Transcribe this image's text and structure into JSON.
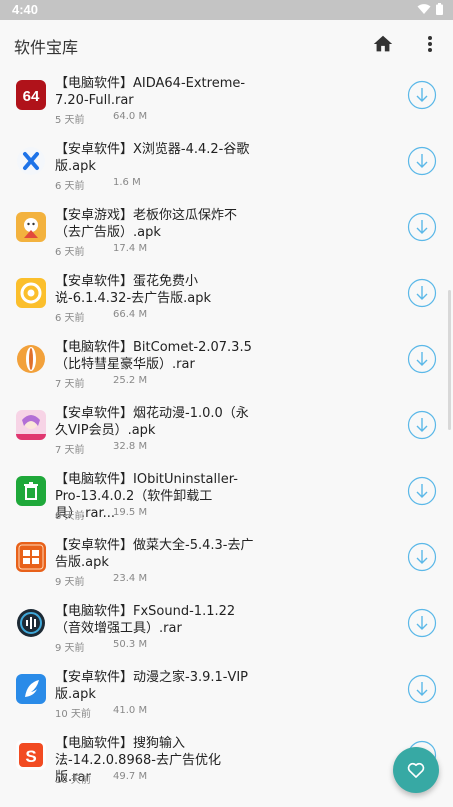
{
  "status_bar": {
    "time": "4:40"
  },
  "app_bar": {
    "title": "软件宝库",
    "home_icon": "home-icon",
    "more_icon": "more-vert-icon"
  },
  "items": [
    {
      "name": "【电脑软件】AIDA64-Extreme-7.20-Full.rar",
      "date": "5 天前",
      "size": "64.0 M",
      "icon": "aida64-icon"
    },
    {
      "name": "【安卓软件】X浏览器-4.4.2-谷歌版.apk",
      "date": "6 天前",
      "size": "1.6 M",
      "icon": "x-browser-icon"
    },
    {
      "name": "【安卓游戏】老板你这瓜保炸不（去广告版）.apk",
      "date": "6 天前",
      "size": "17.4 M",
      "icon": "melon-game-icon"
    },
    {
      "name": "【安卓软件】蛋花免费小说-6.1.4.32-去广告版.apk",
      "date": "6 天前",
      "size": "66.4 M",
      "icon": "novel-icon"
    },
    {
      "name": "【电脑软件】BitComet-2.07.3.5（比特彗星豪华版）.rar",
      "date": "7 天前",
      "size": "25.2 M",
      "icon": "bitcomet-icon"
    },
    {
      "name": "【安卓软件】烟花动漫-1.0.0（永久VIP会员）.apk",
      "date": "7 天前",
      "size": "32.8 M",
      "icon": "anime-icon"
    },
    {
      "name": "【电脑软件】IObitUninstaller-Pro-13.4.0.2（软件卸载工具）.rar...",
      "date": "8 天前",
      "size": "19.5 M",
      "icon": "uninstaller-icon"
    },
    {
      "name": "【安卓软件】做菜大全-5.4.3-去广告版.apk",
      "date": "9 天前",
      "size": "23.4 M",
      "icon": "recipe-icon"
    },
    {
      "name": "【电脑软件】FxSound-1.1.22（音效增强工具）.rar",
      "date": "9 天前",
      "size": "50.3 M",
      "icon": "fxsound-icon"
    },
    {
      "name": "【安卓软件】动漫之家-3.9.1-VIP版.apk",
      "date": "10 天前",
      "size": "41.0 M",
      "icon": "dmzj-icon"
    },
    {
      "name": "【电脑软件】搜狗输入法-14.2.0.8968-去广告优化版.rar",
      "date": "10 天前",
      "size": "49.7 M",
      "icon": "sogou-icon"
    }
  ],
  "colors": {
    "accent": "#5bb8e8",
    "fab": "#37a9a4"
  },
  "fab": {
    "icon": "heart-icon"
  }
}
